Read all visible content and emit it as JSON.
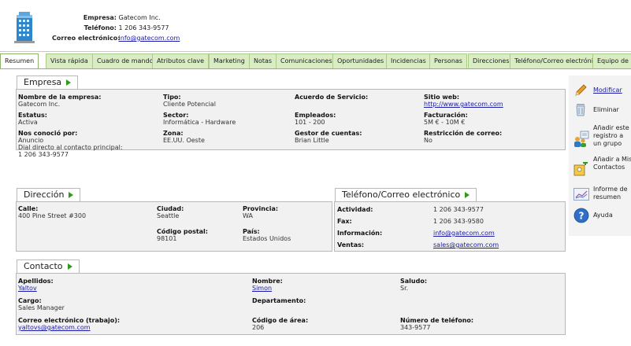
{
  "header": {
    "company_label": "Empresa:",
    "company_value": "Gatecom Inc.",
    "phone_label": "Teléfono:",
    "phone_value": "1 206 343-9577",
    "email_label": "Correo electrónico:",
    "email_value": "info@gatecom.com",
    "logo_icon": "building-icon"
  },
  "tabs": [
    "Resumen",
    "Vista rápida",
    "Cuadro de mando",
    "Atributos clave",
    "Marketing",
    "Notas",
    "Comunicaciones",
    "Oportunidades",
    "Incidencias",
    "Personas",
    "Direcciones",
    "Teléfono/Correo electrónico",
    "Equipo de"
  ],
  "empresa": {
    "title": "Empresa",
    "nombre_label": "Nombre de la empresa:",
    "nombre_value": "Gatecom Inc.",
    "estatus_label": "Estatus:",
    "estatus_value": "Activa",
    "conocio_label": "Nos conoció por:",
    "conocio_value": "Anuncio",
    "dial_label": "Dial directo al contacto principal:",
    "dial_value": "1 206 343-9577",
    "tipo_label": "Tipo:",
    "tipo_value": "Cliente Potencial",
    "sector_label": "Sector:",
    "sector_value": "Informática - Hardware",
    "zona_label": "Zona:",
    "zona_value": "EE.UU. Oeste",
    "acuerdo_label": "Acuerdo de Servicio:",
    "empleados_label": "Empleados:",
    "empleados_value": "101 - 200",
    "gestor_label": "Gestor de cuentas:",
    "gestor_value": "Brian Little",
    "web_label": "Sitio web:",
    "web_value": "http://www.gatecom.com",
    "facturacion_label": "Facturación:",
    "facturacion_value": "5M € - 10M €",
    "restriccion_label": "Restricción de correo:",
    "restriccion_value": "No"
  },
  "direccion": {
    "title": "Dirección",
    "calle_label": "Calle:",
    "calle_value": "400 Pine Street #300",
    "ciudad_label": "Ciudad:",
    "ciudad_value": "Seattle",
    "provincia_label": "Provincia:",
    "provincia_value": "WA",
    "cp_label": "Código postal:",
    "cp_value": "98101",
    "pais_label": "País:",
    "pais_value": "Estados Unidos"
  },
  "telefono": {
    "title": "Teléfono/Correo electrónico",
    "rows": [
      {
        "label": "Actividad:",
        "value": "1 206 343-9577"
      },
      {
        "label": "Fax:",
        "value": "1 206 343-9580"
      },
      {
        "label": "Información:",
        "value": "info@gatecom.com"
      },
      {
        "label": "Ventas:",
        "value": "sales@gatecom.com"
      }
    ]
  },
  "contacto": {
    "title": "Contacto",
    "apellidos_label": "Apellidos:",
    "apellidos_value": "Yaltov",
    "cargo_label": "Cargo:",
    "cargo_value": "Sales Manager",
    "correo_label": "Correo electrónico (trabajo):",
    "correo_value": "yaltovs@gatecom.com",
    "nombre_label": "Nombre:",
    "nombre_value": "Simon",
    "departamento_label": "Departamento:",
    "area_label": "Código de área:",
    "area_value": "206",
    "saludo_label": "Saludo:",
    "saludo_value": "Sr.",
    "numero_label": "Número de teléfono:",
    "numero_value": "343-9577"
  },
  "sidebar": {
    "modificar": "Modificar",
    "eliminar": "Eliminar",
    "anadir_grupo": "Añadir este registro a un grupo",
    "anadir_contactos": "Añadir a Mis Contactos",
    "informe": "Informe de resumen",
    "ayuda": "Ayuda"
  },
  "colors": {
    "accent_green": "#2e9a17",
    "tab_green": "#d9ecc4",
    "link": "#1a1aa8"
  }
}
